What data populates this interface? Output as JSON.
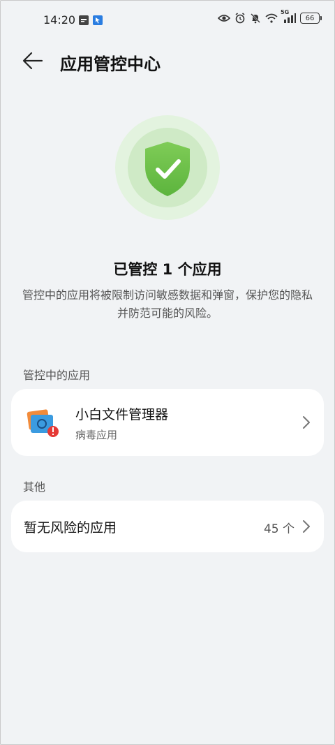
{
  "status_bar": {
    "time": "14:20",
    "network": "5G",
    "battery": "66"
  },
  "header": {
    "title": "应用管控中心"
  },
  "summary": {
    "headline": "已管控 1 个应用",
    "description": "管控中的应用将被限制访问敏感数据和弹窗，保护您的隐私并防范可能的风险。"
  },
  "controlled_section": {
    "label": "管控中的应用",
    "apps": [
      {
        "name": "小白文件管理器",
        "tag": "病毒应用"
      }
    ]
  },
  "other_section": {
    "label": "其他",
    "items": [
      {
        "label": "暂无风险的应用",
        "count": "45 个"
      }
    ]
  },
  "colors": {
    "background": "#f1f3f5",
    "shield_green": "#6cc04a",
    "warning_red": "#e53935"
  }
}
